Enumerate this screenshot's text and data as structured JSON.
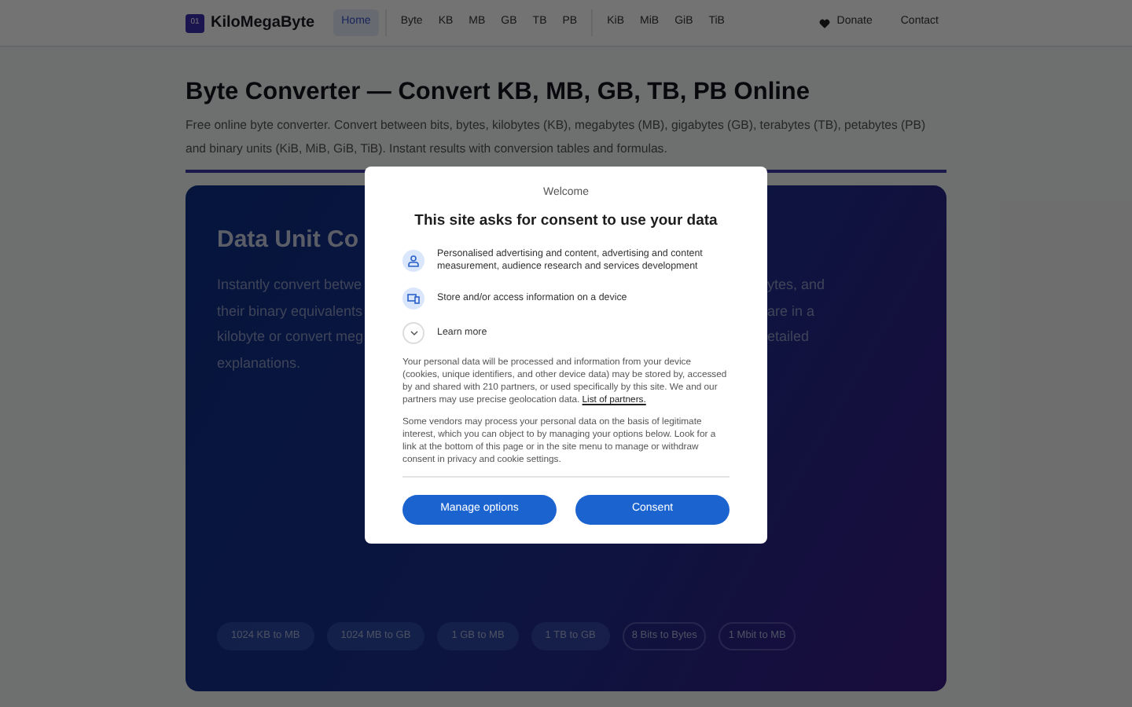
{
  "brand": {
    "badge": "01",
    "name": "KiloMegaByte"
  },
  "nav": {
    "groups": [
      {
        "items": [
          {
            "label": "Home",
            "selected": true
          }
        ]
      },
      {
        "items": [
          {
            "label": "Byte",
            "selected": false
          },
          {
            "label": "KB",
            "selected": false
          },
          {
            "label": "MB",
            "selected": false
          },
          {
            "label": "GB",
            "selected": false
          },
          {
            "label": "TB",
            "selected": false
          },
          {
            "label": "PB",
            "selected": false
          }
        ]
      },
      {
        "items": [
          {
            "label": "KiB",
            "selected": false
          },
          {
            "label": "MiB",
            "selected": false
          },
          {
            "label": "GiB",
            "selected": false
          },
          {
            "label": "TiB",
            "selected": false
          }
        ]
      }
    ],
    "links": [
      {
        "label": "Donate",
        "kind": "donate"
      },
      {
        "label": "Contact",
        "kind": "plain"
      }
    ]
  },
  "heading": "Byte Converter — Convert KB, MB, GB, TB, PB Online",
  "intro": "Free online byte converter. Convert between bits, bytes, kilobytes (KB), megabytes (MB), gigabytes (GB), terabytes (TB), petabytes (PB) and binary units (KiB, MiB, GiB, TiB). Instant results with conversion tables and formulas.",
  "hero": {
    "title": "Data Unit Co",
    "lines": [
      {
        "left": "Instantly convert betwe",
        "right": "ytes, and"
      },
      {
        "left": "their binary equivalents",
        "right": "are in a"
      },
      {
        "left": "kilobyte or convert meg",
        "right": "etailed"
      },
      {
        "left": "explanations."
      }
    ],
    "chips": [
      {
        "label": "1024 KB to MB",
        "kind": "filled"
      },
      {
        "label": "1024 MB to GB",
        "kind": "filled"
      },
      {
        "label": "1 GB to MB",
        "kind": "filled"
      },
      {
        "label": "1 TB to GB",
        "kind": "filled"
      },
      {
        "label": "8 Bits to Bytes",
        "kind": "outline"
      },
      {
        "label": "1 Mbit to MB",
        "kind": "outline"
      }
    ]
  },
  "consent": {
    "welcome": "Welcome",
    "title": "This site asks for consent to use your data",
    "purposes": [
      {
        "kind": "person",
        "text": "Personalised advertising and content, advertising and content measurement, audience research and services development"
      },
      {
        "kind": "device",
        "text": "Store and/or access information on a device"
      }
    ],
    "learn_more": "Learn more",
    "paragraphs": [
      {
        "text": "Your personal data will be processed and information from your device (cookies, unique identifiers, and other device data) may be stored by, accessed by and shared with 210 partners, or used specifically by this site. We and our partners may use precise geolocation data. ",
        "link": "List of partners."
      },
      {
        "text": "Some vendors may process your personal data on the basis of legitimate interest, which you can object to by managing your options below. Look for a link at the bottom of this page or in the site menu to manage or withdraw consent in privacy and cookie settings."
      }
    ],
    "buttons": [
      "Manage options",
      "Consent"
    ]
  }
}
